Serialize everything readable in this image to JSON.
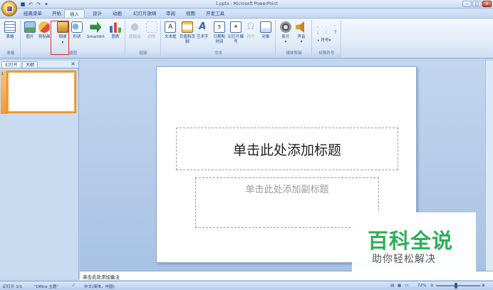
{
  "window": {
    "title": "1.pptx - Microsoft PowerPoint"
  },
  "tabs": [
    {
      "label": "经典菜单"
    },
    {
      "label": "开始"
    },
    {
      "label": "插入"
    },
    {
      "label": "设计"
    },
    {
      "label": "动画"
    },
    {
      "label": "幻灯片放映"
    },
    {
      "label": "审阅"
    },
    {
      "label": "视图"
    },
    {
      "label": "开发工具"
    }
  ],
  "ribbon": {
    "groups": {
      "table": "表格",
      "illustrations": "插图",
      "links": "链接",
      "text": "文本",
      "media": "媒体剪辑",
      "special": "特殊符号"
    },
    "buttons": {
      "table": "表格",
      "picture": "图片",
      "clipart": "剪贴画",
      "album": "相册",
      "shapes": "形状",
      "smartart": "SmartArt",
      "chart": "图表",
      "hyperlink": "超链接",
      "action": "动作",
      "textbox": "文本框",
      "header_footer": "页眉和页脚",
      "wordart": "艺术字",
      "datetime": "日期和时间",
      "slide_number": "幻灯片编号",
      "symbol": "符号",
      "object": "对象",
      "movie": "影片",
      "sound": "声音",
      "symbols_menu": "符号"
    }
  },
  "left_pane": {
    "tab_slides": "幻灯片",
    "tab_outline": "大纲",
    "slide_number": "1"
  },
  "slide": {
    "title_placeholder": "单击此处添加标题",
    "subtitle_placeholder": "单击此处添加副标题"
  },
  "notes": {
    "placeholder": "单击此处添加备注"
  },
  "status": {
    "slide_info": "幻灯片 1/1",
    "theme": "\"Office 主题\"",
    "language": "中文(简体，中国)",
    "zoom": "72%"
  },
  "watermark": {
    "title": "百科全说",
    "subtitle": "助你轻松解决"
  },
  "colors": {
    "ribbon_bg": "#e2ecf8",
    "highlight": "#e02b2b",
    "watermark_green": "#2fae5a"
  }
}
